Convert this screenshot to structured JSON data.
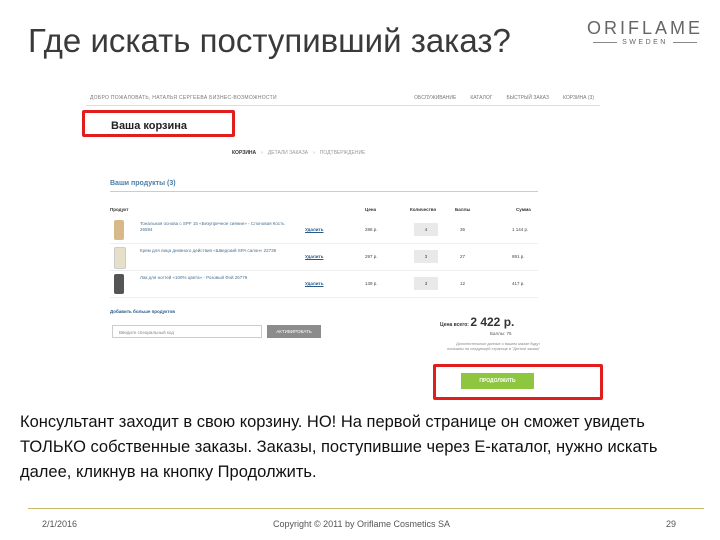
{
  "slide": {
    "title": "Где искать поступивший заказ?",
    "logo_main": "ORIFLAME",
    "logo_sub": "SWEDEN",
    "body": "Консультант заходит в свою корзину. НО! На первой странице он сможет увидеть ТОЛЬКО собственные заказы. Заказы, поступившие через Е-каталог, нужно искать далее, кликнув на кнопку Продолжить.",
    "footer_date": "2/1/2016",
    "footer_copyright": "Copyright © 2011 by Oriflame Cosmetics SA",
    "footer_page": "29",
    "highlight_color": "#e11d1d"
  },
  "screenshot": {
    "topbar_left": "ДОБРО ПОЖАЛОВАТЬ, НАТАЛЬЯ СЕРГЕЕВА   БИЗНЕС-ВОЗМОЖНОСТИ",
    "topbar_links": [
      "ОБСЛУЖИВАНИЕ",
      "КАТАЛОГ",
      "БЫСТРЫЙ ЗАКАЗ",
      "КОРЗИНА (3)"
    ],
    "cart_heading": "Ваша корзина",
    "steps": [
      "КОРЗИНА",
      "›",
      "ДЕТАЛИ ЗАКАЗА",
      "›",
      "ПОДТВЕРЖДЕНИЕ"
    ],
    "products_title": "Ваши продукты (3)",
    "columns": {
      "product": "Продукт",
      "price": "Цена",
      "qty": "Количество",
      "points": "Баллы",
      "sum": "Сумма"
    },
    "items": [
      {
        "name": "Тональная основа с SPF 15 «Безупречное сияние» - Слоновая Кость",
        "code": "26594",
        "delete": "Удалить",
        "price": "286 р.",
        "qty": "4",
        "points": "36",
        "sum": "1 144 р.",
        "color": "#d8b98a"
      },
      {
        "name": "Крем для лица дневного действия «Шведский SPA салон»",
        "code": "22739",
        "delete": "Удалить",
        "price": "297 р.",
        "qty": "3",
        "points": "27",
        "sum": "891 р.",
        "color": "#e6e0c8"
      },
      {
        "name": "Лак для ногтей «100% цвета» - Розовый Фэй",
        "code": "26779",
        "delete": "Удалить",
        "price": "139 р.",
        "qty": "3",
        "points": "12",
        "sum": "417 р.",
        "color": "#555555"
      }
    ],
    "more_link": "Добавить больше продуктов",
    "coupon_placeholder": "Введите специальный код",
    "coupon_button": "АКТИВИРОВАТЬ",
    "total_label": "Цена всего:",
    "total_amount": "2 422 р.",
    "total_points": "Баллы: 75",
    "note": "Дополнительные данные о вашем заказе будут показаны на следующей странице в \"Детали заказа\"",
    "continue_button": "ПРОДОЛЖИТЬ"
  }
}
